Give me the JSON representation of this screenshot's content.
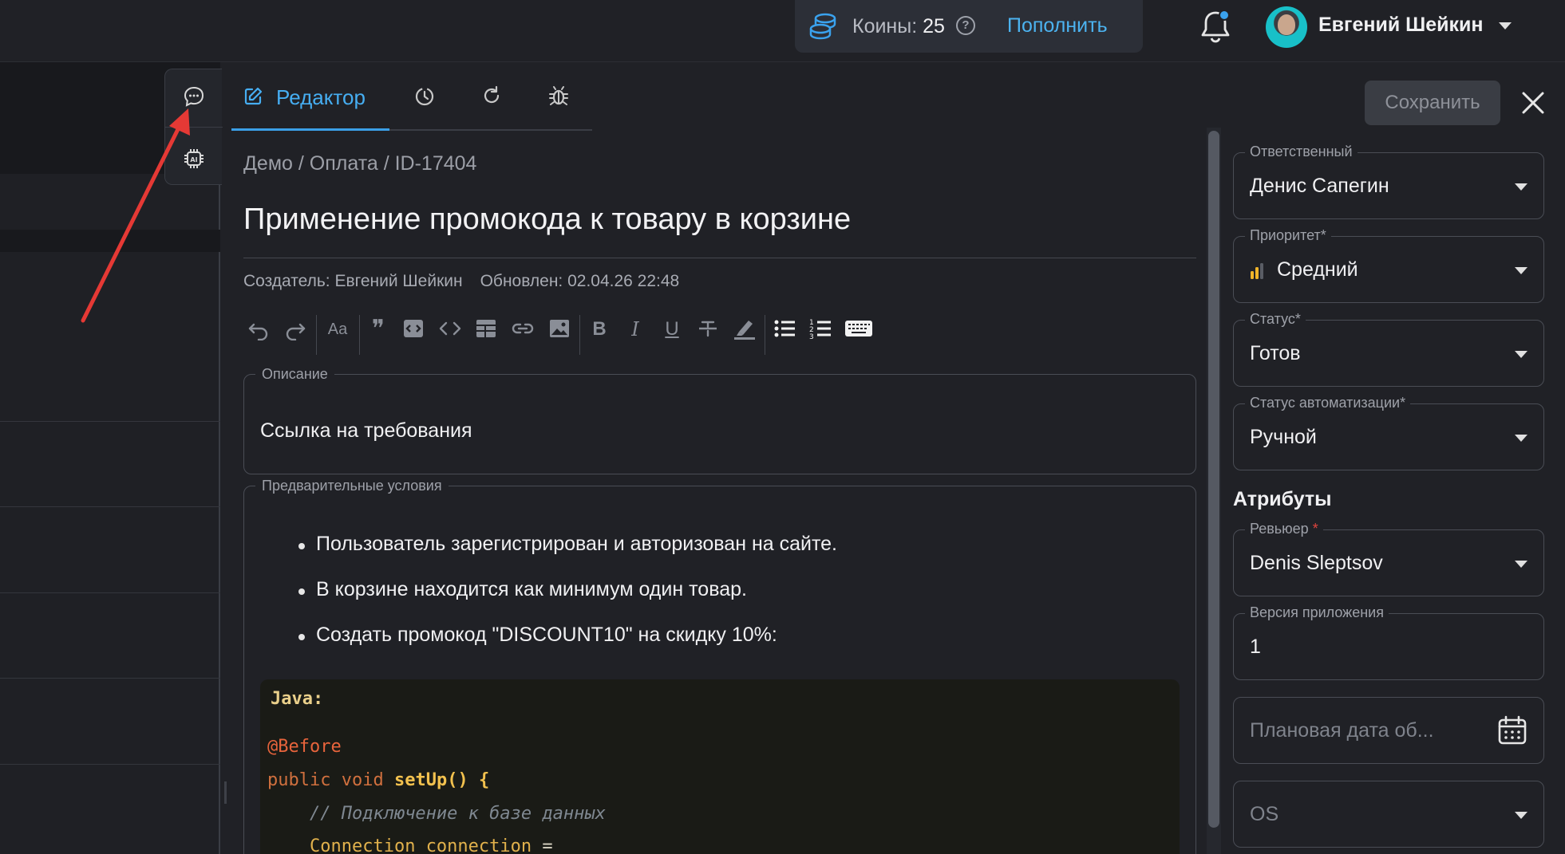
{
  "header": {
    "coins_label": "Коины:",
    "coins_count": "25",
    "help_glyph": "?",
    "topup_label": "Пополнить",
    "user_name": "Евгений Шейкин"
  },
  "tabs": [
    {
      "label": "Редактор",
      "icon": "edit-icon"
    },
    {
      "icon": "history-icon"
    },
    {
      "icon": "refresh-icon"
    },
    {
      "icon": "bug-icon"
    }
  ],
  "actions": {
    "save_label": "Сохранить"
  },
  "case": {
    "breadcrumb": "Демо / Оплата / ID-17404",
    "title": "Применение промокода к товару в корзине",
    "creator": "Создатель: Евгений Шейкин",
    "updated": "Обновлен: 02.04.26 22:48"
  },
  "toolbar_icons": [
    "undo-icon",
    "redo-icon",
    "text-size-icon",
    "quote-icon",
    "code-block-icon",
    "inline-code-icon",
    "table-icon",
    "link-icon",
    "image-icon",
    "bold-icon",
    "italic-icon",
    "underline-icon",
    "strikethrough-icon",
    "highlighter-icon",
    "bullet-list-icon",
    "numbered-list-icon",
    "keyboard-icon"
  ],
  "toolbar_glyphs": {
    "text_size": "Aa",
    "bold": "B",
    "italic": "I",
    "underline": "U",
    "quote": "❞"
  },
  "description": {
    "legend": "Описание",
    "text": "Ссылка на требования"
  },
  "preconditions": {
    "legend": "Предварительные условия",
    "items": [
      "Пользователь зарегистрирован и авторизован на сайте.",
      "В корзине находится как минимум один товар.",
      "Создать промокод \"DISCOUNT10\" на скидку 10%:"
    ],
    "code": {
      "language": "Java:",
      "annotation": "@Before",
      "kw_public": "public",
      "kw_void": "void",
      "fn": "setUp",
      "sig_rest": "() {",
      "comment": "// Подключение к базе данных",
      "type": "Connection",
      "var": "connection",
      "assign": "="
    }
  },
  "panel": {
    "assignee": {
      "label": "Ответственный",
      "value": "Денис Сапегин"
    },
    "priority": {
      "label": "Приоритет*",
      "value": "Средний",
      "color": "#f0b429"
    },
    "status": {
      "label": "Статус*",
      "value": "Готов"
    },
    "automation": {
      "label": "Статус автоматизации*",
      "value": "Ручной"
    },
    "attributes_title": "Атрибуты",
    "reviewer": {
      "label": "Ревьюер",
      "required": "*",
      "value": "Denis Sleptsov"
    },
    "app_version": {
      "label": "Версия приложения",
      "value": "1"
    },
    "planned_date": {
      "placeholder": "Плановая дата об..."
    },
    "os": {
      "placeholder": "OS"
    }
  },
  "colors": {
    "accent": "#46aef2",
    "annotation_arrow": "#e53935"
  }
}
